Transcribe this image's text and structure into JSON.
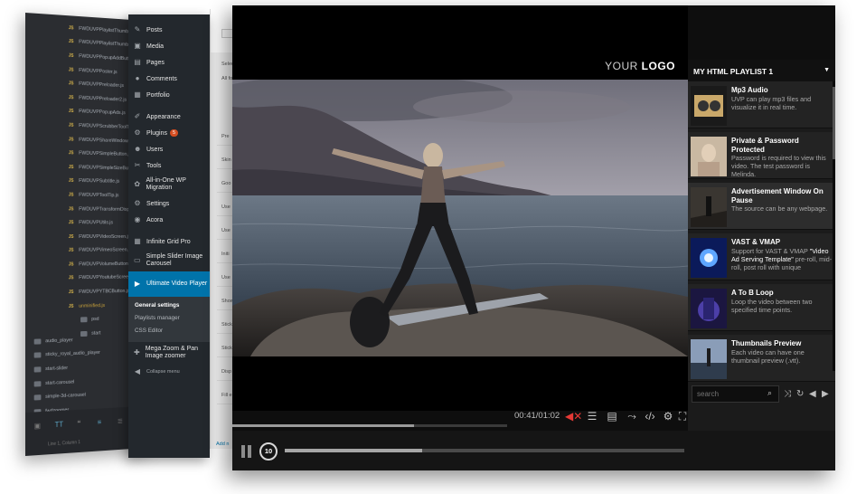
{
  "editor": {
    "files": [
      "FWDUVPPlaylistThumb.js",
      "FWDUVPPlaylistThumbs.js",
      "FWDUVPPopupAddButton.js",
      "FWDUVPPoster.js",
      "FWDUVPPreloader.js",
      "FWDUVPPreloader2.js",
      "FWDUVPPopupAds.js",
      "FWDUVPScrubberToolTip.js",
      "FWDUVPShareWindow.js",
      "FWDUVPSimpleButton.js",
      "FWDUVPSimpleSizeButton.js",
      "FWDUVPSubtitle.js",
      "FWDUVPToolTip.js",
      "FWDUVPTransformDisplay.js",
      "FWDUVPUtils.js",
      "FWDUVPVideoScreen.js",
      "FWDUVPVimeoScreen.js",
      "FWDUVPVolumeButton.js",
      "FWDUVPYoutubeScreen.js",
      "FWDUVPYTBCButton.js",
      "unminified.js"
    ],
    "js_tag": "JS",
    "folders_inner": [
      "psd",
      "start"
    ],
    "folders_outer": [
      "audio_player",
      "sticky_royal_audio_player",
      "start-slider",
      "start-carousel",
      "simple-3d-carousel",
      "fwdzoomer"
    ],
    "status": "Line 1, Column 1"
  },
  "wp_menu": {
    "items": [
      {
        "icon": "pin-icon",
        "glyph": "✎",
        "label": "Posts"
      },
      {
        "icon": "media-icon",
        "glyph": "▣",
        "label": "Media"
      },
      {
        "icon": "pages-icon",
        "glyph": "▤",
        "label": "Pages"
      },
      {
        "icon": "comments-icon",
        "glyph": "●",
        "label": "Comments"
      },
      {
        "icon": "portfolio-icon",
        "glyph": "▦",
        "label": "Portfolio"
      },
      {
        "icon": "appearance-icon",
        "glyph": "✐",
        "label": "Appearance"
      },
      {
        "icon": "plugins-icon",
        "glyph": "⚙",
        "label": "Plugins",
        "badge": "5"
      },
      {
        "icon": "users-icon",
        "glyph": "☻",
        "label": "Users"
      },
      {
        "icon": "tools-icon",
        "glyph": "✂",
        "label": "Tools"
      },
      {
        "icon": "migration-icon",
        "glyph": "✿",
        "label": "All-in-One WP Migration"
      },
      {
        "icon": "settings-icon",
        "glyph": "⚙",
        "label": "Settings"
      },
      {
        "icon": "acora-icon",
        "glyph": "◉",
        "label": "Acora"
      },
      {
        "icon": "grid-icon",
        "glyph": "▦",
        "label": "Infinite Grid Pro"
      },
      {
        "icon": "carousel-icon",
        "glyph": "▭",
        "label": "Simple Slider Image Carousel"
      },
      {
        "icon": "uvp-icon",
        "glyph": "▶",
        "label": "Ultimate Video Player"
      }
    ],
    "submenu": [
      "General settings",
      "Playlists manager",
      "CSS Editor"
    ],
    "after": [
      {
        "icon": "zoom-icon",
        "glyph": "✚",
        "label": "Mega Zoom & Pan Image zoomer"
      },
      {
        "icon": "collapse-icon",
        "glyph": "◀",
        "label": "Collapse menu"
      }
    ]
  },
  "wp_page": {
    "intro": [
      "Select yo",
      "All form"
    ],
    "labels": [
      "Pre",
      "Skin",
      "Goo",
      "Use",
      "Use",
      "Initi",
      "Use",
      "Show",
      "Stick",
      "Stick",
      "Disp",
      "Fill e"
    ],
    "add_button": "Add n"
  },
  "player": {
    "logo_prefix": "YOUR",
    "logo_bold": "LOGO",
    "time": "00:41/01:02",
    "progress_fraction": 0.66,
    "playlist_title": "MY HTML PLAYLIST 1",
    "search_placeholder": "search",
    "rewind_label": "10",
    "playlist": [
      {
        "title": "Mp3 Audio",
        "desc": "UVP can play mp3 files and visualize it in real time."
      },
      {
        "title": "Private & Password Protected",
        "desc": "Password is required to view this video. The test password is Melinda."
      },
      {
        "title": "Advertisement Window On Pause",
        "desc": "The source can be any webpage."
      },
      {
        "title": "VAST & VMAP",
        "desc_prefix": "Support for VAST & VMAP ",
        "desc_bold": "\"Video Ad Serving Template\"",
        "desc_suffix": " pre-roll, mid-roll, post roll with unique"
      },
      {
        "title": "A To B Loop",
        "desc": "Loop the video between two specified time points."
      },
      {
        "title": "Thumbnails Preview",
        "desc": "Each video can have one thumbnail preview (.vtt)."
      }
    ]
  }
}
